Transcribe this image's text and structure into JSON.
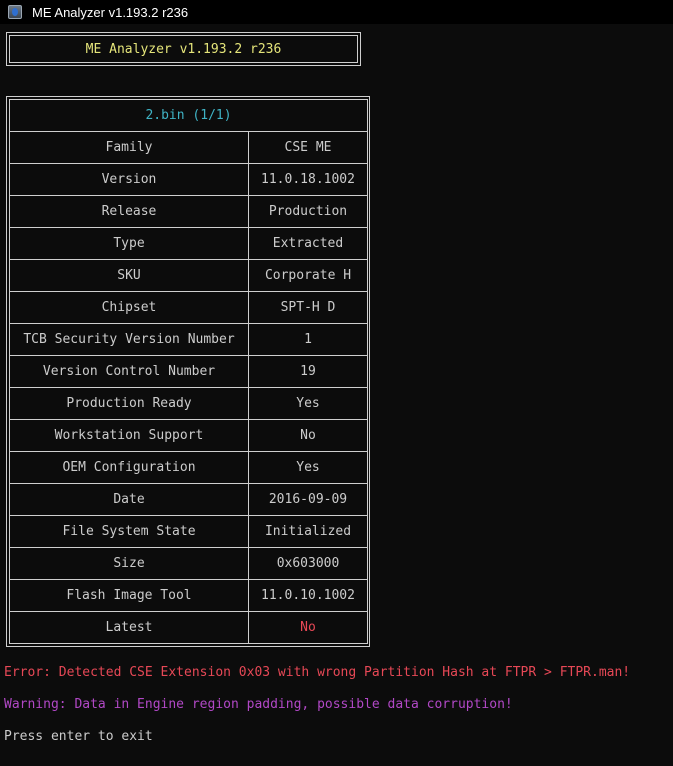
{
  "window": {
    "title": "ME Analyzer v1.193.2 r236",
    "icon": "me-analyzer-app-icon"
  },
  "header": {
    "banner": "ME Analyzer v1.193.2 r236"
  },
  "table": {
    "caption": "2.bin (1/1)",
    "rows": [
      {
        "label": "Family",
        "value": "CSE ME"
      },
      {
        "label": "Version",
        "value": "11.0.18.1002"
      },
      {
        "label": "Release",
        "value": "Production"
      },
      {
        "label": "Type",
        "value": "Extracted"
      },
      {
        "label": "SKU",
        "value": "Corporate H"
      },
      {
        "label": "Chipset",
        "value": "SPT-H D"
      },
      {
        "label": "TCB Security Version Number",
        "value": "1"
      },
      {
        "label": "Version Control Number",
        "value": "19"
      },
      {
        "label": "Production Ready",
        "value": "Yes"
      },
      {
        "label": "Workstation Support",
        "value": "No"
      },
      {
        "label": "OEM Configuration",
        "value": "Yes"
      },
      {
        "label": "Date",
        "value": "2016-09-09"
      },
      {
        "label": "File System State",
        "value": "Initialized"
      },
      {
        "label": "Size",
        "value": "0x603000"
      },
      {
        "label": "Flash Image Tool",
        "value": "11.0.10.1002"
      },
      {
        "label": "Latest",
        "value": "No"
      }
    ]
  },
  "messages": {
    "error": "Error: Detected CSE Extension 0x03 with wrong Partition Hash at FTPR > FTPR.man!",
    "warning": "Warning: Data in Engine region padding, possible data corruption!",
    "exit": "Press enter to exit"
  },
  "colors": {
    "background": "#0c0c0c",
    "text": "#cccccc",
    "banner": "#e5e57a",
    "caption": "#3fb3c5",
    "error": "#e74856",
    "warning": "#b148c6"
  }
}
